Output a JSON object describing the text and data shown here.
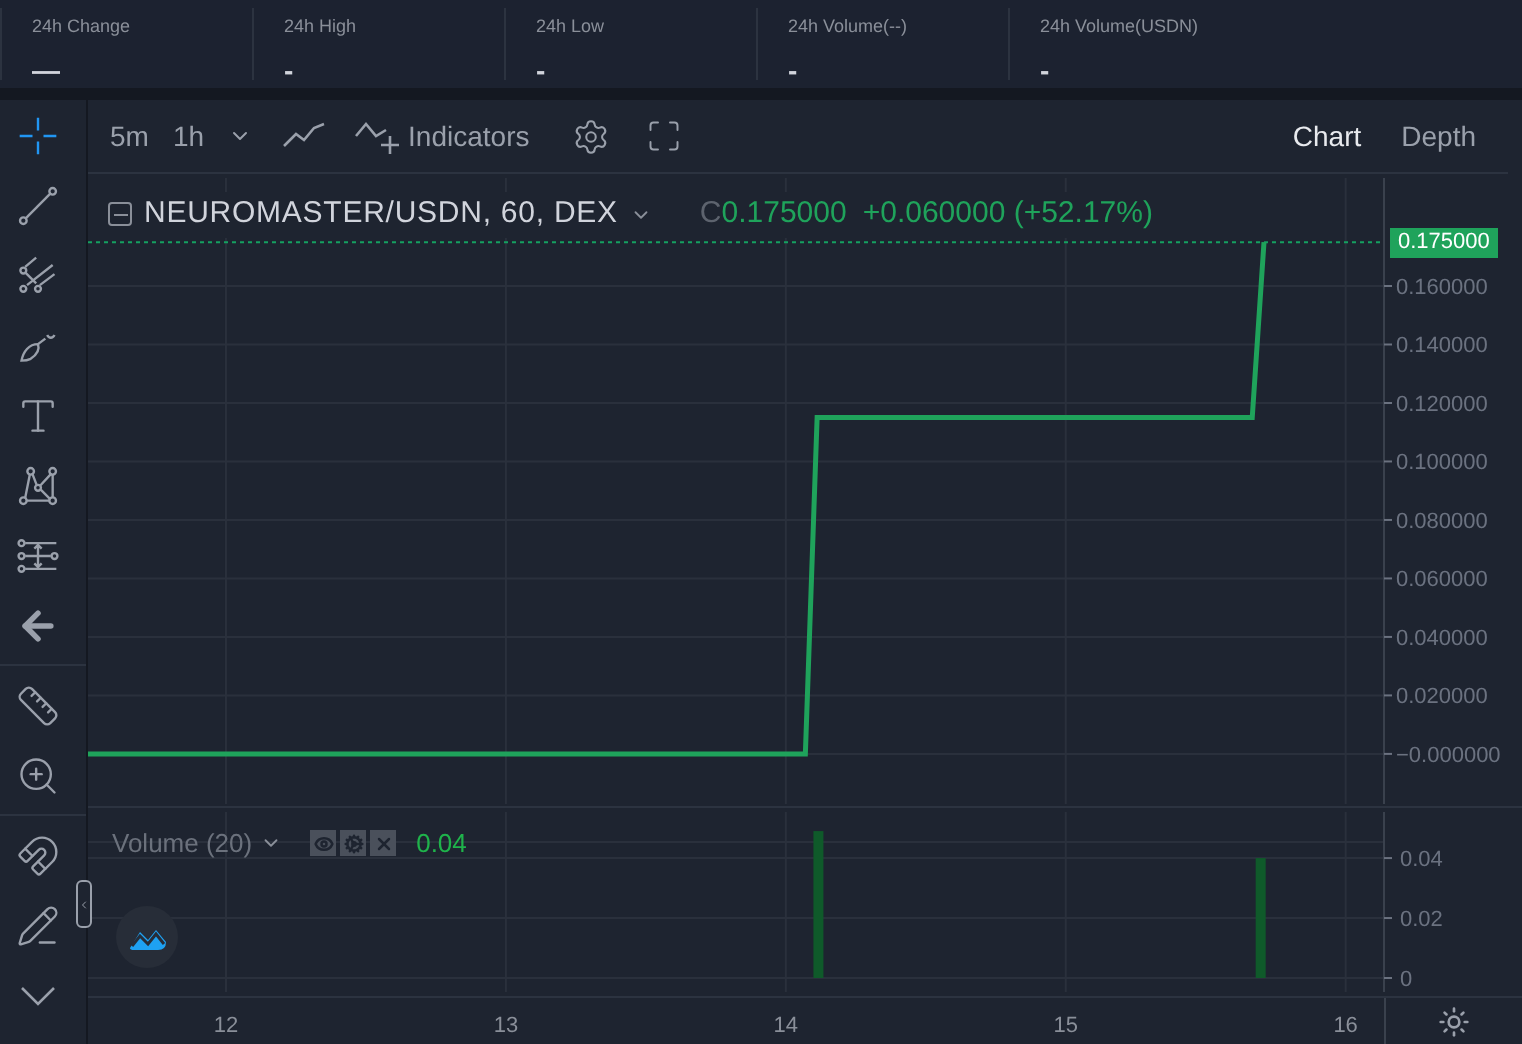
{
  "stats": [
    {
      "label": "24h Change",
      "value": "—"
    },
    {
      "label": "24h High",
      "value": "-"
    },
    {
      "label": "24h Low",
      "value": "-"
    },
    {
      "label": "24h Volume(--)",
      "value": "-"
    },
    {
      "label": "24h Volume(USDN)",
      "value": "-"
    }
  ],
  "toolbar": {
    "intervals": [
      "5m",
      "1h"
    ],
    "indicators_label": "Indicators",
    "views": [
      {
        "label": "Chart",
        "selected": true
      },
      {
        "label": "Depth",
        "selected": false
      }
    ]
  },
  "tools": [
    {
      "kind": "crosshair",
      "selected": true
    },
    {
      "kind": "trendline",
      "selected": false
    },
    {
      "kind": "fork",
      "selected": false
    },
    {
      "kind": "brush",
      "selected": false
    },
    {
      "kind": "text",
      "selected": false
    },
    {
      "kind": "pattern",
      "selected": false
    },
    {
      "kind": "measure",
      "selected": false
    },
    {
      "kind": "back",
      "selected": false
    },
    {
      "kind": "divider"
    },
    {
      "kind": "ruler",
      "selected": false
    },
    {
      "kind": "zoom",
      "selected": false
    },
    {
      "kind": "divider"
    },
    {
      "kind": "magnet",
      "selected": false
    },
    {
      "kind": "lock",
      "selected": false
    },
    {
      "kind": "more",
      "selected": false
    }
  ],
  "price_pane": {
    "symbol": "NEUROMASTER/USDN, 60, DEX",
    "close_label": "C",
    "close": "0.175000",
    "change": "+0.060000 (+52.17%)",
    "last_price": "0.175000",
    "chart_data": {
      "type": "line",
      "categories": [
        null,
        null,
        null,
        null,
        null,
        null,
        null,
        null,
        null,
        null,
        null,
        null,
        null,
        null,
        null,
        null,
        null,
        null,
        null,
        null,
        null,
        null,
        null,
        null,
        null,
        null,
        null,
        null,
        null,
        null,
        null,
        null,
        null,
        null,
        null,
        null,
        null,
        null,
        null,
        null,
        null,
        null,
        null,
        null,
        null,
        null,
        null,
        null,
        null,
        null,
        null,
        null,
        null,
        null,
        null,
        null,
        null,
        null,
        null,
        null,
        null,
        null,
        null,
        null,
        null,
        null,
        null,
        null,
        null,
        null,
        null,
        null,
        null,
        null,
        null,
        null,
        null,
        null,
        null,
        null,
        null,
        null,
        null,
        null,
        null,
        null,
        null,
        null,
        null,
        null,
        null,
        null,
        null,
        null,
        null,
        null,
        null,
        null,
        null,
        null,
        null
      ],
      "series": [
        {
          "color": "#1fa35b",
          "values": [
            0,
            0,
            0,
            0,
            0,
            0,
            0,
            0,
            0,
            0,
            0,
            0,
            0,
            0,
            0,
            0,
            0,
            0,
            0,
            0,
            0,
            0,
            0,
            0,
            0,
            0,
            0,
            0,
            0,
            0,
            0,
            0,
            0,
            0,
            0,
            0,
            0,
            0,
            0,
            0,
            0,
            0,
            0,
            0,
            0,
            0,
            0,
            0,
            0,
            0,
            0,
            0,
            0,
            0,
            0,
            0,
            0,
            0,
            0,
            0,
            0,
            0,
            0.115,
            0.115,
            0.115,
            0.115,
            0.115,
            0.115,
            0.115,
            0.115,
            0.115,
            0.115,
            0.115,
            0.115,
            0.115,
            0.115,
            0.115,
            0.115,
            0.115,
            0.115,
            0.115,
            0.115,
            0.115,
            0.115,
            0.115,
            0.115,
            0.115,
            0.115,
            0.115,
            0.115,
            0.115,
            0.115,
            0.115,
            0.115,
            0.115,
            0.115,
            0.115,
            0.115,
            0.115,
            0.115,
            0.175
          ]
        }
      ],
      "ylim": [
        -0.0185,
        0.1983
      ],
      "yticks": [
        {
          "value": 0,
          "label": "−0.000000"
        },
        {
          "value": 0.02,
          "label": "0.020000"
        },
        {
          "value": 0.04,
          "label": "0.040000"
        },
        {
          "value": 0.06,
          "label": "0.060000"
        },
        {
          "value": 0.08,
          "label": "0.080000"
        },
        {
          "value": 0.1,
          "label": "0.100000"
        },
        {
          "value": 0.12,
          "label": "0.120000"
        },
        {
          "value": 0.14,
          "label": "0.140000"
        },
        {
          "value": 0.16,
          "label": "0.160000"
        }
      ],
      "grid": true,
      "ref_lines": [
        {
          "axis": "y",
          "value": 0.175
        }
      ]
    }
  },
  "volume_pane": {
    "title": "Volume (20)",
    "value": "0.04",
    "chart_data": {
      "type": "bar",
      "x": [
        14.12,
        15.7
      ],
      "series": [
        {
          "color": "#0f5a2a",
          "values": [
            0.049,
            0.04
          ]
        }
      ],
      "xlim": [
        11.507,
        16.63
      ],
      "xticks": [
        12,
        13,
        14,
        15,
        16
      ],
      "ylim": [
        -0.006,
        0.0567
      ],
      "yticks": [
        {
          "value": 0,
          "label": "0"
        },
        {
          "value": 0.02,
          "label": "0.02"
        },
        {
          "value": 0.04,
          "label": "0.04"
        }
      ],
      "grid": true
    }
  }
}
